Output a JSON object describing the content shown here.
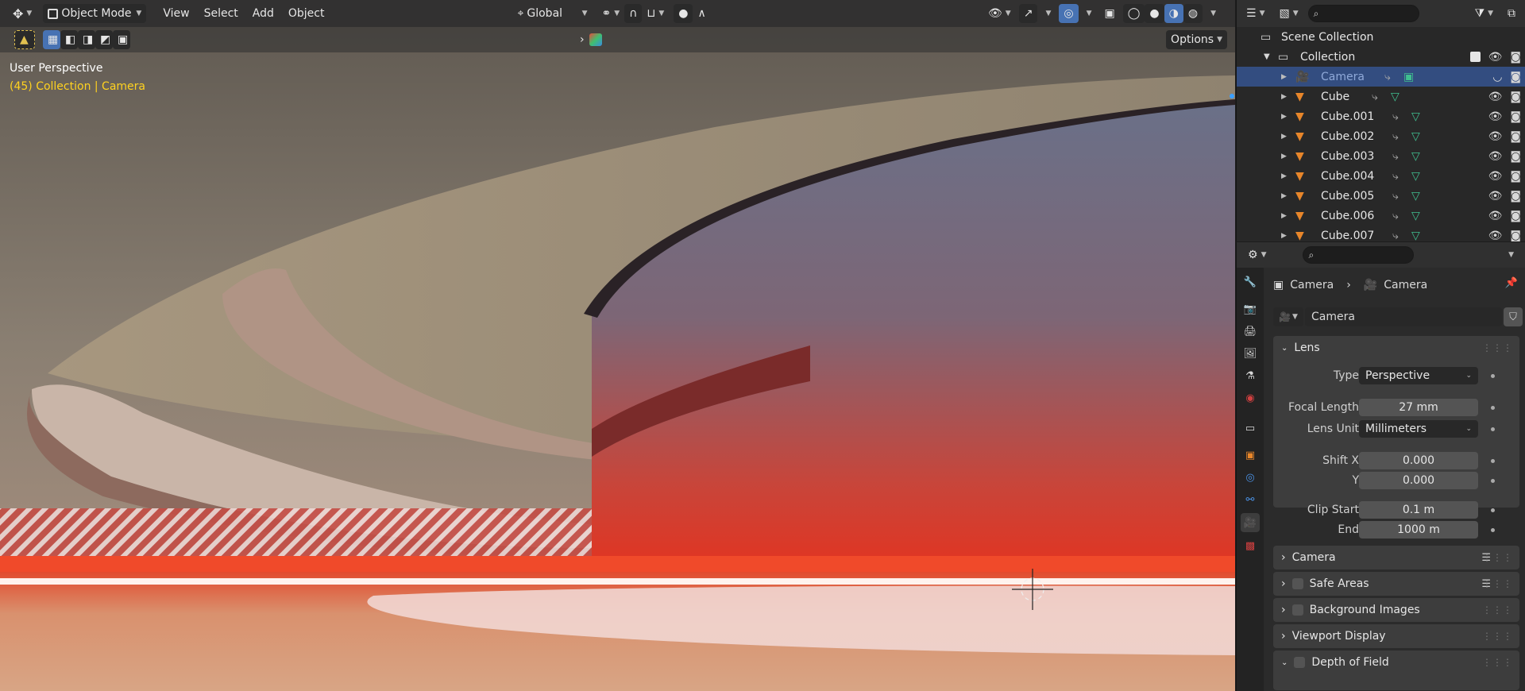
{
  "viewport": {
    "header": {
      "mode_label": "Object Mode",
      "menus": [
        "View",
        "Select",
        "Add",
        "Object"
      ],
      "transform_orientation": "Global"
    },
    "tool_header": {
      "options_label": "Options"
    },
    "overlay": {
      "perspective": "User Perspective",
      "info": "(45) Collection | Camera"
    }
  },
  "outliner": {
    "scene_collection": "Scene Collection",
    "collection": "Collection",
    "items": [
      {
        "name": "Camera",
        "type": "camera",
        "selected": true
      },
      {
        "name": "Cube",
        "type": "mesh",
        "selected": false
      },
      {
        "name": "Cube.001",
        "type": "mesh",
        "selected": false
      },
      {
        "name": "Cube.002",
        "type": "mesh",
        "selected": false
      },
      {
        "name": "Cube.003",
        "type": "mesh",
        "selected": false
      },
      {
        "name": "Cube.004",
        "type": "mesh",
        "selected": false
      },
      {
        "name": "Cube.005",
        "type": "mesh",
        "selected": false
      },
      {
        "name": "Cube.006",
        "type": "mesh",
        "selected": false
      },
      {
        "name": "Cube.007",
        "type": "mesh",
        "selected": false
      }
    ]
  },
  "properties": {
    "breadcrumb_object": "Camera",
    "breadcrumb_data": "Camera",
    "datablock_name": "Camera",
    "lens_panel": {
      "title": "Lens",
      "type_label": "Type",
      "type_value": "Perspective",
      "focal_label": "Focal Length",
      "focal_value": "27 mm",
      "lens_unit_label": "Lens Unit",
      "lens_unit_value": "Millimeters",
      "shift_x_label": "Shift X",
      "shift_x_value": "0.000",
      "shift_y_label": "Y",
      "shift_y_value": "0.000",
      "clip_start_label": "Clip Start",
      "clip_start_value": "0.1 m",
      "clip_end_label": "End",
      "clip_end_value": "1000 m"
    },
    "collapsed_panels": [
      "Camera",
      "Safe Areas",
      "Background Images",
      "Viewport Display",
      "Depth of Field"
    ]
  },
  "colors": {
    "selection_blue": "#4772b3",
    "outliner_selected": "#334d80",
    "camera_data_green": "#3fbf8f",
    "mesh_orange": "#e8862a",
    "info_yellow": "#ffd21f"
  }
}
